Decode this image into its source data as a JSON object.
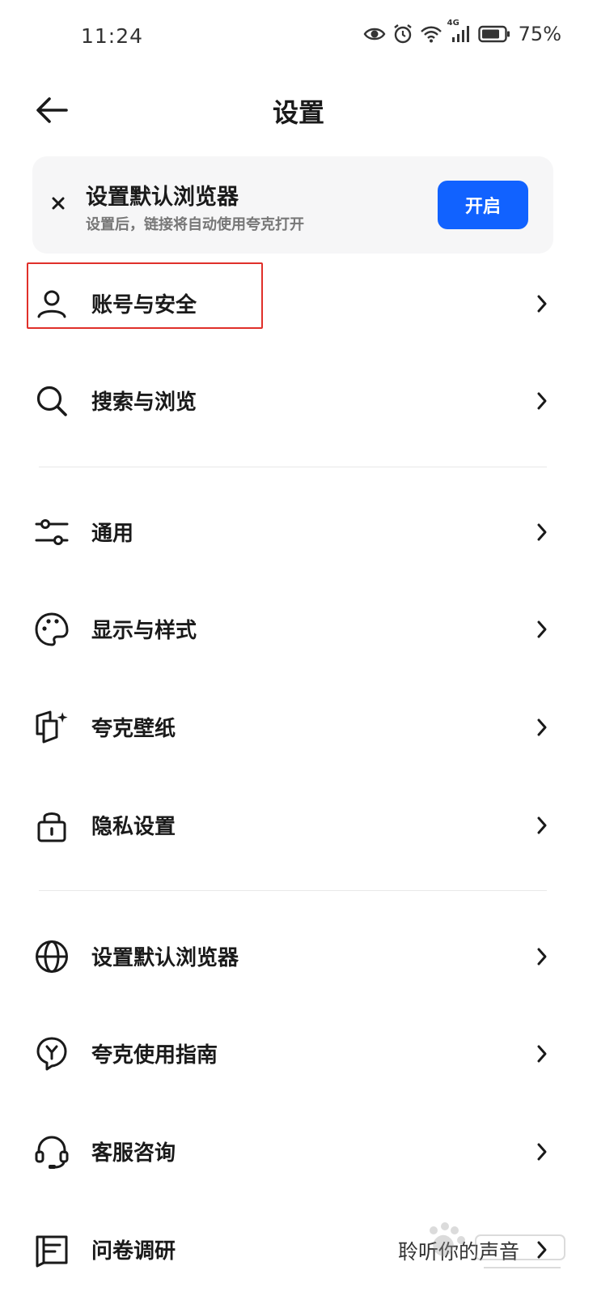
{
  "status_bar": {
    "time": "11:24",
    "network": "4G",
    "battery": "75%"
  },
  "header": {
    "title": "设置"
  },
  "banner": {
    "title": "设置默认浏览器",
    "subtitle": "设置后，链接将自动使用夸克打开",
    "button_label": "开启"
  },
  "menu": {
    "account": {
      "label": "账号与安全",
      "icon": "user-icon"
    },
    "search": {
      "label": "搜索与浏览",
      "icon": "search-icon"
    },
    "general": {
      "label": "通用",
      "icon": "sliders-icon"
    },
    "display": {
      "label": "显示与样式",
      "icon": "palette-icon"
    },
    "wallpaper": {
      "label": "夸克壁纸",
      "icon": "wallpaper-icon"
    },
    "privacy": {
      "label": "隐私设置",
      "icon": "lock-icon"
    },
    "default_browser": {
      "label": "设置默认浏览器",
      "icon": "globe-icon"
    },
    "guide": {
      "label": "夸克使用指南",
      "icon": "guide-icon"
    },
    "support": {
      "label": "客服咨询",
      "icon": "headset-icon"
    },
    "survey": {
      "label": "问卷调研",
      "right_text": "聆听你的声音",
      "icon": "survey-icon"
    }
  },
  "colors": {
    "accent": "#1162ff",
    "highlight": "#e0302a",
    "banner_bg": "#f6f6f7"
  }
}
